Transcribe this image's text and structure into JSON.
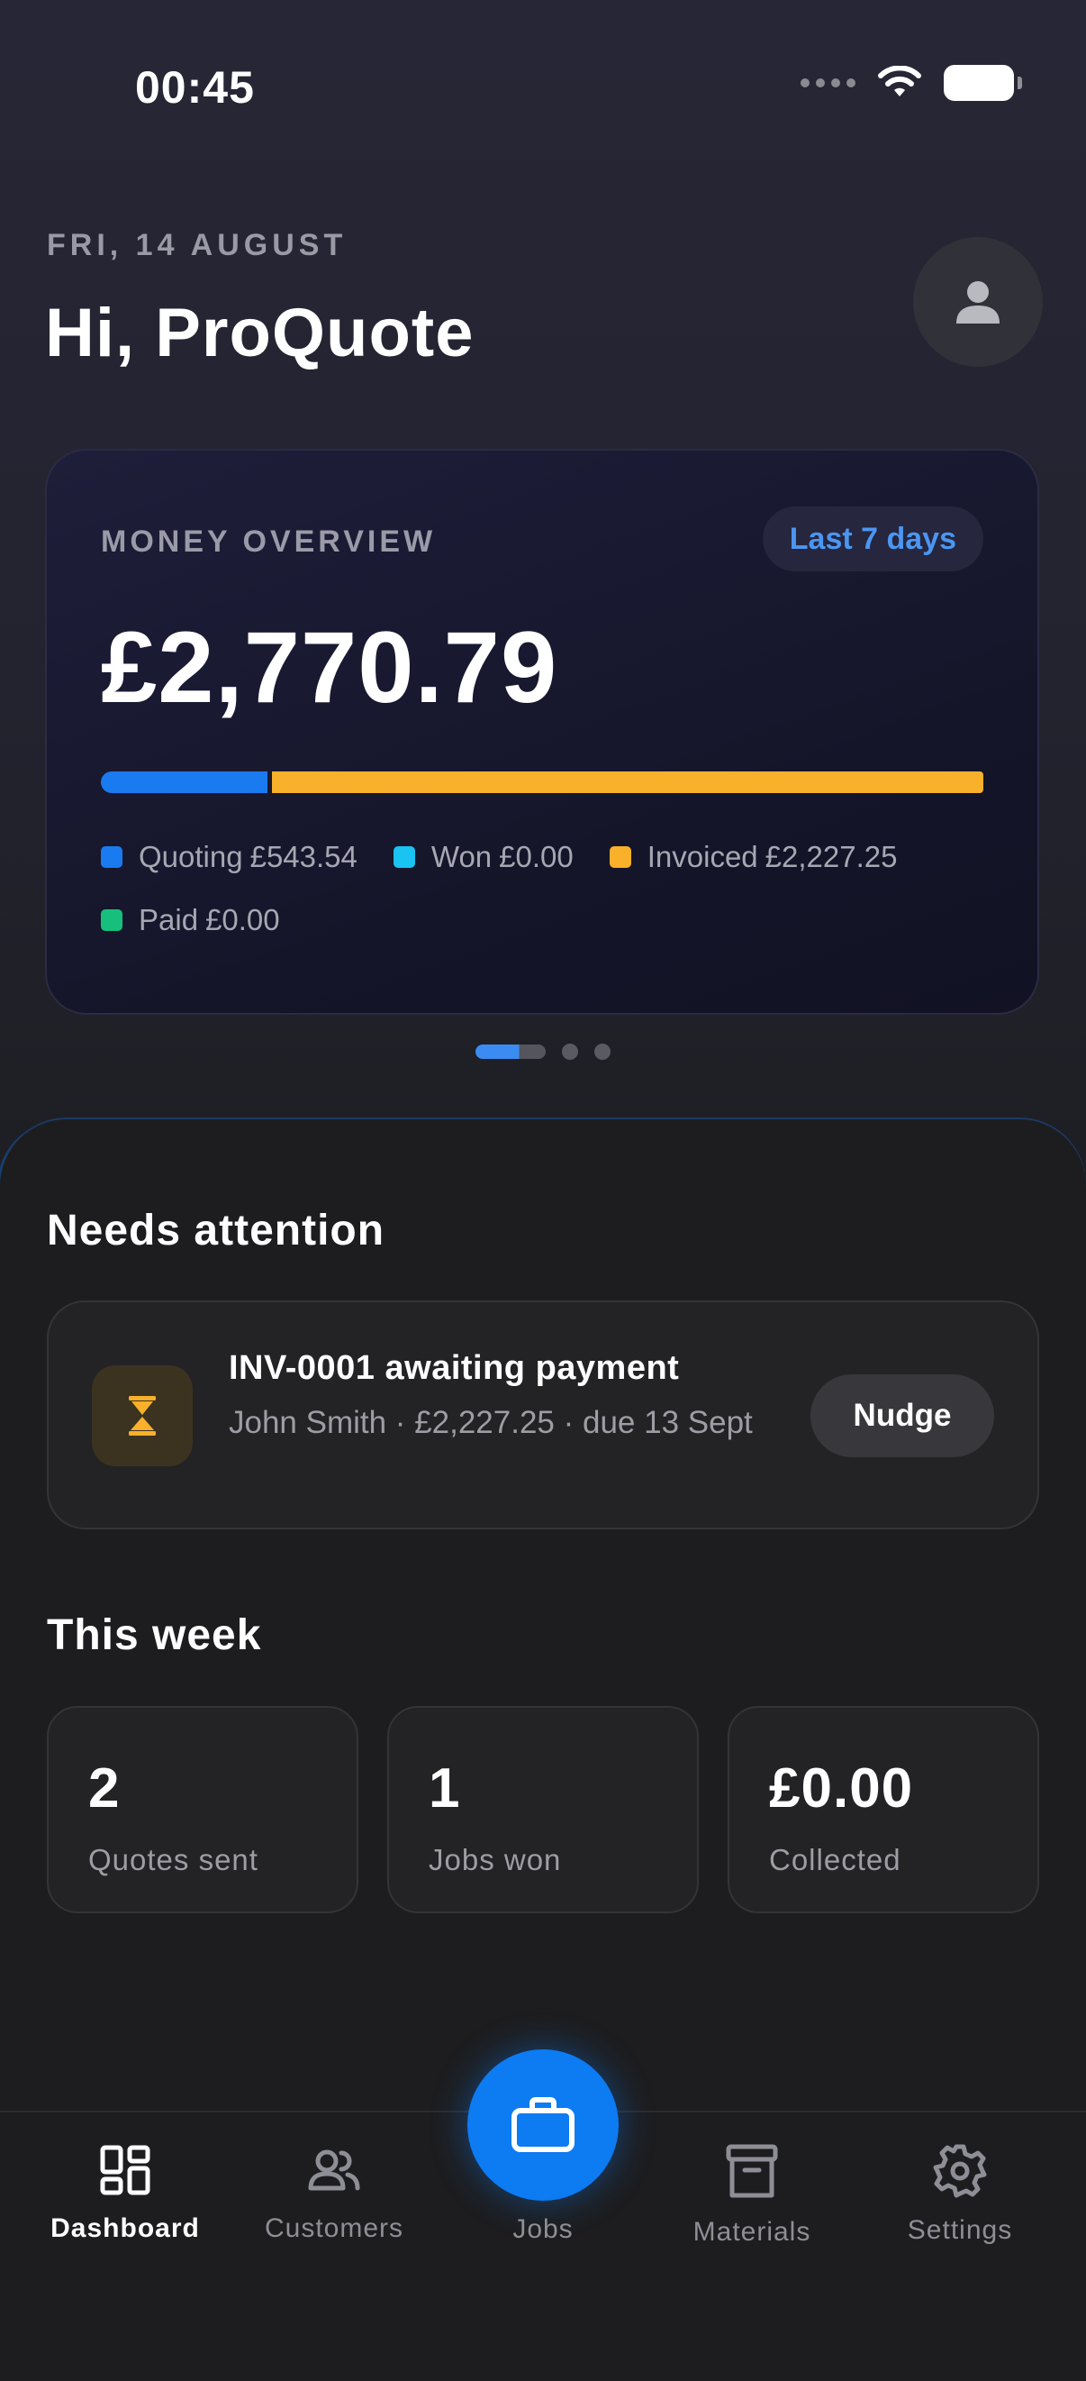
{
  "status_bar": {
    "time": "00:45"
  },
  "header": {
    "date": "FRI, 14 AUGUST",
    "greeting": "Hi, ProQuote"
  },
  "money_overview": {
    "label": "MONEY OVERVIEW",
    "period": "Last 7 days",
    "total": "£2,770.79",
    "breakdown": [
      {
        "name": "Quoting",
        "amount": "£543.54",
        "color": "#1a7af0"
      },
      {
        "name": "Won",
        "amount": "£0.00",
        "color": "#19c3f2"
      },
      {
        "name": "Invoiced",
        "amount": "£2,227.25",
        "color": "#f9b02a"
      },
      {
        "name": "Paid",
        "amount": "£0.00",
        "color": "#16c07c"
      }
    ],
    "pager": {
      "pages": 3,
      "active": 1
    }
  },
  "needs_attention": {
    "title": "Needs attention",
    "items": [
      {
        "icon": "hourglass-icon",
        "title": "INV-0001 awaiting payment",
        "subtitle": "John Smith · £2,227.25 · due 13 Sept",
        "action": "Nudge"
      }
    ]
  },
  "this_week": {
    "title": "This week",
    "stats": [
      {
        "value": "2",
        "label": "Quotes sent"
      },
      {
        "value": "1",
        "label": "Jobs won"
      },
      {
        "value": "£0.00",
        "label": "Collected"
      }
    ]
  },
  "tab_bar": {
    "tabs": [
      {
        "label": "Dashboard",
        "icon": "dashboard-icon",
        "active": true
      },
      {
        "label": "Customers",
        "icon": "customers-icon",
        "active": false
      },
      {
        "label": "Jobs",
        "icon": "briefcase-icon",
        "active": false
      },
      {
        "label": "Materials",
        "icon": "archive-box-icon",
        "active": false
      },
      {
        "label": "Settings",
        "icon": "gear-icon",
        "active": false
      }
    ]
  },
  "colors": {
    "accent": "#0d7bf2",
    "amber": "#f9b02a",
    "background": "#1d1d1f"
  }
}
